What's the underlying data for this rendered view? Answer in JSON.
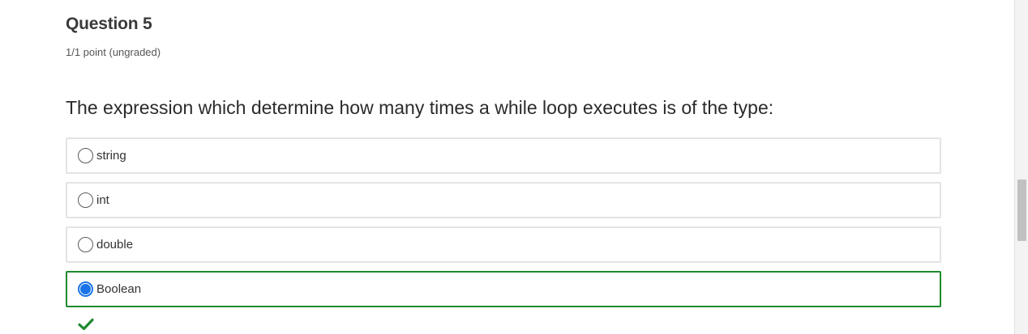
{
  "question": {
    "title": "Question 5",
    "points": "1/1 point (ungraded)",
    "prompt": "The expression which determine how many times a while loop executes is of the type:"
  },
  "options": [
    {
      "label": "string",
      "selected": false
    },
    {
      "label": "int",
      "selected": false
    },
    {
      "label": "double",
      "selected": false
    },
    {
      "label": "Boolean",
      "selected": true
    }
  ],
  "feedback": {
    "icon": "checkmark-icon",
    "color": "#1f8a2e"
  },
  "colors": {
    "selected_border": "#1f8a2e",
    "radio_selected": "#1a73e8"
  }
}
